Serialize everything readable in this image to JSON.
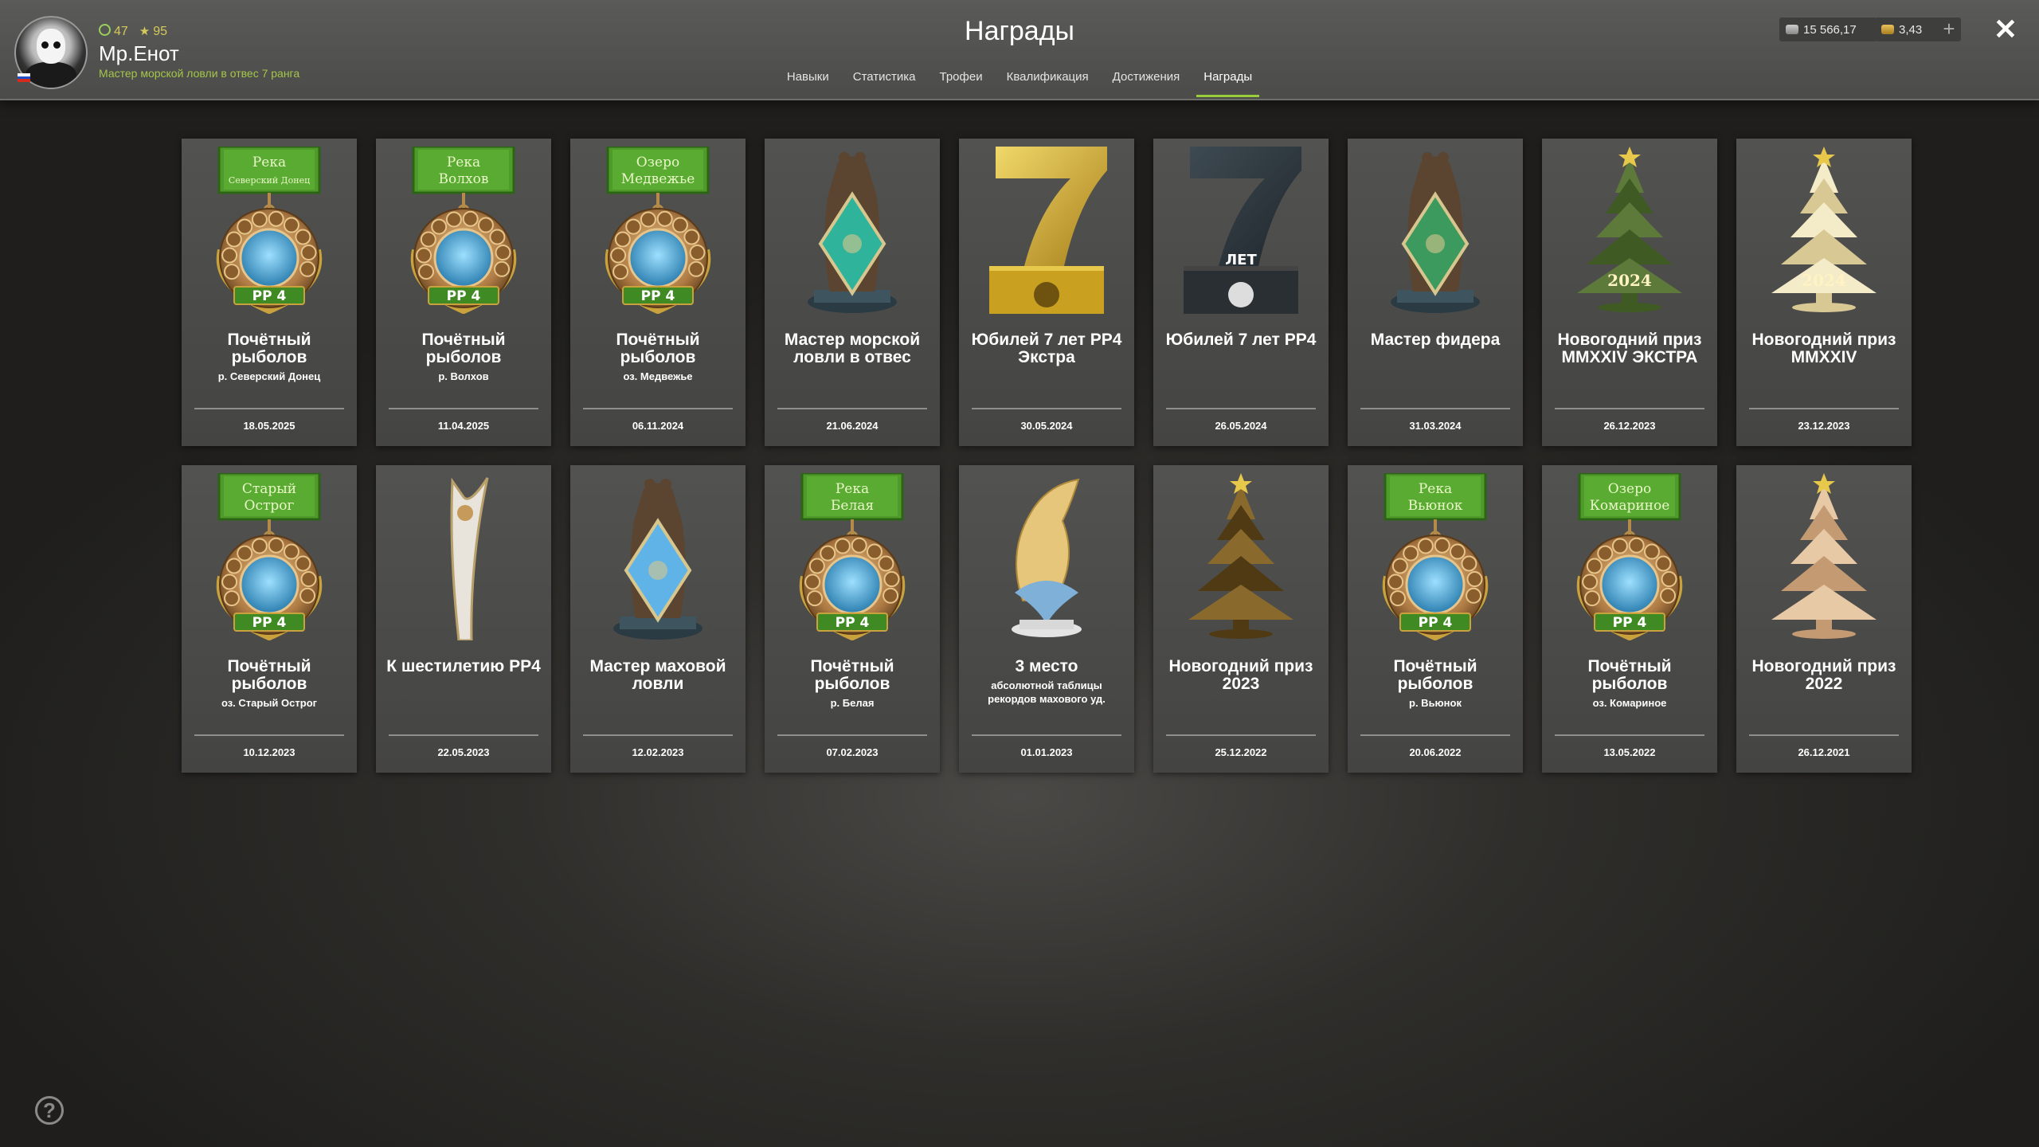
{
  "header": {
    "title": "Награды",
    "level": "47",
    "rank": "95",
    "username": "Мр.Енот",
    "subtitle": "Мастер морской ловли в отвес 7 ранга",
    "silver": "15 566,17",
    "gold": "3,43",
    "plus": "+",
    "close": "✕"
  },
  "tabs": [
    {
      "label": "Навыки"
    },
    {
      "label": "Статистика"
    },
    {
      "label": "Трофеи"
    },
    {
      "label": "Квалификация"
    },
    {
      "label": "Достижения"
    },
    {
      "label": "Награды"
    }
  ],
  "colors": {
    "accent": "#9acd3a",
    "gold": "#d6c85a",
    "medal_green": "#3f8a23"
  },
  "awards": [
    {
      "name": "Почётный рыболов",
      "sub": "р. Северский Донец",
      "date": "18.05.2025",
      "art": "medal",
      "ribbon": [
        "Река",
        "Северский Донец"
      ],
      "emblem": "sunflower-icon"
    },
    {
      "name": "Почётный рыболов",
      "sub": "р. Волхов",
      "date": "11.04.2025",
      "art": "medal",
      "ribbon": [
        "Река",
        "Волхов"
      ],
      "emblem": "bridge-icon"
    },
    {
      "name": "Почётный рыболов",
      "sub": "оз. Медвежье",
      "date": "06.11.2024",
      "art": "medal",
      "ribbon": [
        "Озеро",
        "Медвежье"
      ],
      "emblem": "bear-icon"
    },
    {
      "name": "Мастер морской ловли в отвес",
      "sub": "",
      "date": "21.06.2024",
      "art": "bear",
      "diamond": "#2fb39a"
    },
    {
      "name": "Юбилей 7 лет РР4 Экстра",
      "sub": "",
      "date": "30.05.2024",
      "art": "seven",
      "variant": "gold"
    },
    {
      "name": "Юбилей 7 лет РР4",
      "sub": "",
      "date": "26.05.2024",
      "art": "seven",
      "variant": "dark",
      "label": "ЛЕТ"
    },
    {
      "name": "Мастер фидера",
      "sub": "",
      "date": "31.03.2024",
      "art": "bear",
      "diamond": "#3c9a5e"
    },
    {
      "name": "Новогодний приз MMXXIV ЭКСТРА",
      "sub": "",
      "date": "26.12.2023",
      "art": "tree",
      "variant": "green",
      "label": "2024"
    },
    {
      "name": "Новогодний приз MMXXIV",
      "sub": "",
      "date": "23.12.2023",
      "art": "tree",
      "variant": "cream",
      "label": "2024"
    },
    {
      "name": "Почётный рыболов",
      "sub": "оз. Старый Острог",
      "date": "10.12.2023",
      "art": "medal",
      "ribbon": [
        "Старый",
        "Острог"
      ],
      "emblem": "axes-icon"
    },
    {
      "name": "К шестилетию РР4",
      "sub": "",
      "date": "22.05.2023",
      "art": "blade"
    },
    {
      "name": "Мастер маховой ловли",
      "sub": "",
      "date": "12.02.2023",
      "art": "bear",
      "diamond": "#5fb3e6"
    },
    {
      "name": "Почётный рыболов",
      "sub": "р. Белая",
      "date": "07.02.2023",
      "art": "medal",
      "ribbon": [
        "Река",
        "Белая"
      ],
      "emblem": "tent-icon"
    },
    {
      "name": "3 место",
      "sub": "абсолютной таблицы рекордов махового уд.",
      "date": "01.01.2023",
      "art": "fish"
    },
    {
      "name": "Новогодний приз 2023",
      "sub": "",
      "date": "25.12.2022",
      "art": "tree",
      "variant": "bronze"
    },
    {
      "name": "Почётный рыболов",
      "sub": "р. Вьюнок",
      "date": "20.06.2022",
      "art": "medal",
      "ribbon": [
        "Река",
        "Вьюнок"
      ],
      "emblem": "rods-icon"
    },
    {
      "name": "Почётный рыболов",
      "sub": "оз. Комариное",
      "date": "13.05.2022",
      "art": "medal",
      "ribbon": [
        "Озеро",
        "Комариное"
      ],
      "emblem": "mosquito-icon"
    },
    {
      "name": "Новогодний приз 2022",
      "sub": "",
      "date": "26.12.2021",
      "art": "tree",
      "variant": "wood"
    }
  ],
  "medal_label": "РР 4",
  "help": "?"
}
